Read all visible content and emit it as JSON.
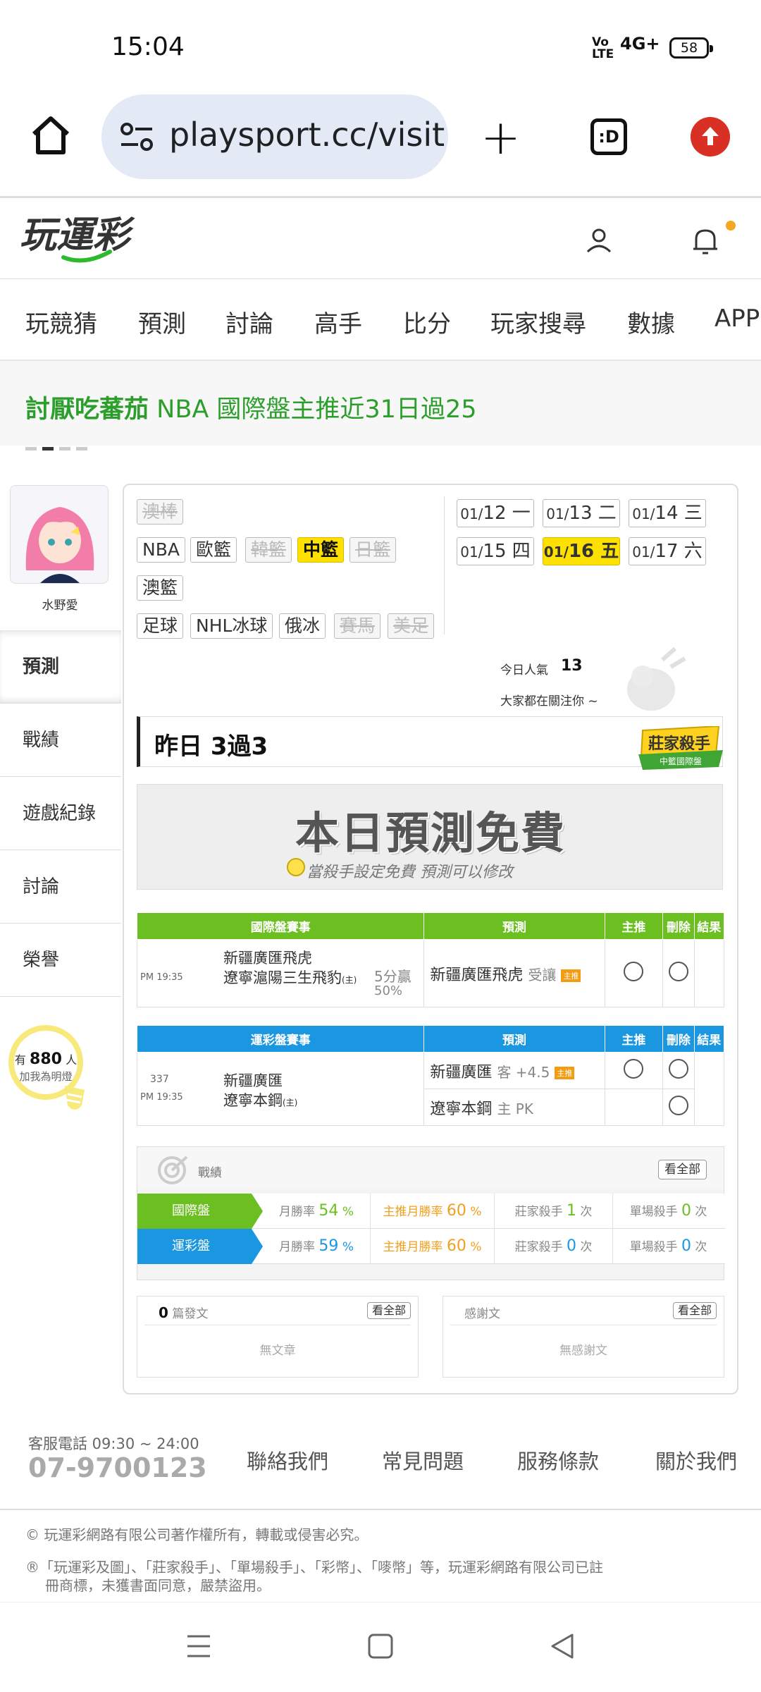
{
  "status_bar": {
    "time": "15:04",
    "volte": "Vo\nLTE",
    "network": "4G+",
    "battery": "58"
  },
  "browser": {
    "url": "playsport.cc/visit",
    "tabs_label": ":D"
  },
  "site": {
    "logo_text": "玩運彩"
  },
  "nav": {
    "items": [
      "玩競猜",
      "預測",
      "討論",
      "高手",
      "比分",
      "玩家搜尋",
      "數據",
      "APP"
    ]
  },
  "banner": {
    "name": "討厭吃蕃茄",
    "text": "NBA 國際盤主推近31日過25"
  },
  "profile": {
    "name": "水野愛",
    "menu": [
      "預測",
      "戰績",
      "遊戲紀錄",
      "討論",
      "榮譽"
    ],
    "fans_prefix": "有",
    "fans_count": "880",
    "fans_suffix": "人",
    "fans_label": "加我為明燈"
  },
  "leagues": {
    "row1": [
      {
        "label": "澳棒",
        "disabled": true
      }
    ],
    "row2": [
      {
        "label": "NBA"
      },
      {
        "label": "歐籃"
      },
      {
        "label": "韓籃",
        "disabled": true
      },
      {
        "label": "中籃",
        "selected": true
      },
      {
        "label": "日籃",
        "disabled": true
      }
    ],
    "row3": [
      {
        "label": "澳籃"
      }
    ],
    "row4": [
      {
        "label": "足球"
      },
      {
        "label": "NHL冰球"
      },
      {
        "label": "俄冰"
      },
      {
        "label": "賽馬",
        "disabled": true
      },
      {
        "label": "美足",
        "disabled": true
      }
    ]
  },
  "dates": [
    {
      "md": "01/",
      "day": "12",
      "wd": "一"
    },
    {
      "md": "01/",
      "day": "13",
      "wd": "二"
    },
    {
      "md": "01/",
      "day": "14",
      "wd": "三"
    },
    {
      "md": "01/",
      "day": "15",
      "wd": "四"
    },
    {
      "md": "01/",
      "day": "16",
      "wd": "五",
      "selected": true
    },
    {
      "md": "01/",
      "day": "17",
      "wd": "六"
    }
  ],
  "popularity": {
    "label": "今日人氣",
    "value": "13",
    "sub": "大家都在關注你 ~"
  },
  "record": {
    "title": "昨日 3過3",
    "badge_line1": "莊家殺手",
    "badge_line2": "中籃國際盤"
  },
  "free_banner": {
    "title": "本日預測免費",
    "subtitle": "當殺手設定免費  預測可以修改"
  },
  "intl_table": {
    "headers": [
      "國際盤賽事",
      "預測",
      "主推",
      "刪除",
      "結果"
    ],
    "time": "PM 19:35",
    "home": "新疆廣匯飛虎",
    "away": "遼寧滬陽三生飛豹",
    "away_tag": "(主)",
    "spread": "5分贏",
    "spread_pct": "50%",
    "pick_team": "新疆廣匯飛虎",
    "pick_type": "受讓",
    "pick_badge": "主推"
  },
  "lottery_table": {
    "headers": [
      "運彩盤賽事",
      "預測",
      "主推",
      "刪除",
      "結果"
    ],
    "game_no": "337",
    "time": "PM 19:35",
    "home": "新疆廣匯",
    "away": "遼寧本鋼",
    "away_tag": "(主)",
    "pick1_team": "新疆廣匯",
    "pick1_type": "客 +4.5",
    "pick1_badge": "主推",
    "pick2_team": "遼寧本鋼",
    "pick2_type": "主 PK"
  },
  "stats": {
    "label": "戰績",
    "view_all": "看全部",
    "rows": [
      {
        "name": "國際盤",
        "month_label": "月勝率",
        "month_val": "54",
        "main_label": "主推月勝率",
        "main_val": "60",
        "killer_label": "莊家殺手",
        "killer_val": "1",
        "single_label": "單場殺手",
        "single_val": "0",
        "unit_pct": "%",
        "unit_times": "次"
      },
      {
        "name": "運彩盤",
        "month_label": "月勝率",
        "month_val": "59",
        "main_label": "主推月勝率",
        "main_val": "60",
        "killer_label": "莊家殺手",
        "killer_val": "0",
        "single_label": "單場殺手",
        "single_val": "0",
        "unit_pct": "%",
        "unit_times": "次"
      }
    ],
    "colors": {
      "intl": "#6cbf21",
      "lottery": "#1a97e0",
      "month": "#6cbf21",
      "main": "#f0a020",
      "lottery_month": "#1a97e0"
    }
  },
  "articles": {
    "count": "0",
    "label": "篇發文",
    "view_all": "看全部",
    "empty": "無文章"
  },
  "thanks": {
    "label": "感謝文",
    "view_all": "看全部",
    "empty": "無感謝文"
  },
  "footer": {
    "service_hours": "客服電話 09:30 ~ 24:00",
    "phone": "07-9700123",
    "links": [
      "聯絡我們",
      "常見問題",
      "服務條款",
      "關於我們"
    ],
    "copyright": "© 玩運彩網路有限公司著作權所有，轉載或侵害必究。",
    "trademark1": "®「玩運彩及圖」、「莊家殺手」、「單場殺手」、「彩幣」、「嘜幣」等，玩運彩網路有限公司已註",
    "trademark2": "冊商標，未獲書面同意，嚴禁盜用。"
  }
}
